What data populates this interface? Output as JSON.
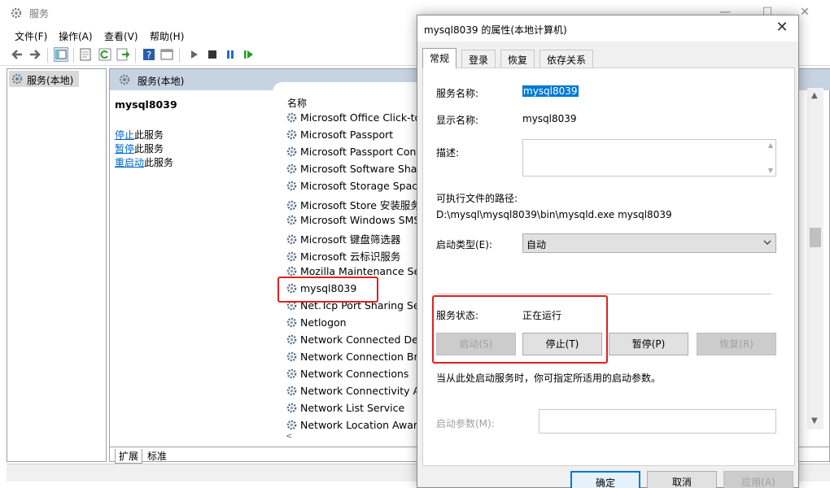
{
  "window": {
    "title": "服务",
    "minimize": "—",
    "maximize": "☐",
    "close": "✕"
  },
  "menu": [
    "文件(F)",
    "操作(A)",
    "查看(V)",
    "帮助(H)"
  ],
  "tree": {
    "root": "服务(本地)"
  },
  "pane_header": "服务(本地)",
  "selected_service": {
    "name": "mysql8039",
    "stop_link": "停止",
    "stop_rest": "此服务",
    "pause_link": "暂停",
    "pause_rest": "此服务",
    "restart_link": "重启动",
    "restart_rest": "此服务"
  },
  "list": {
    "column_name": "名称",
    "items": [
      "Microsoft Office Click-to",
      "Microsoft Passport",
      "Microsoft Passport Cont",
      "Microsoft Software Shad",
      "Microsoft Storage Space",
      "Microsoft Store 安装服务",
      "Microsoft Windows SMS",
      "Microsoft 键盘筛选器",
      "Microsoft 云标识服务",
      "Mozilla Maintenance Ser",
      "mysql8039",
      "Net.Tcp Port Sharing Ser",
      "Netlogon",
      "Network Connected Dev",
      "Network Connection Bro",
      "Network Connections",
      "Network Connectivity As",
      "Network List Service",
      "Network Location Aware"
    ]
  },
  "bottom_tabs": [
    "扩展",
    "标准"
  ],
  "dialog": {
    "title": "mysql8039 的属性(本地计算机)",
    "close": "✕",
    "tabs": [
      "常规",
      "登录",
      "恢复",
      "依存关系"
    ],
    "service_name_label": "服务名称:",
    "service_name_value": "mysql8039",
    "display_name_label": "显示名称:",
    "display_name_value": "mysql8039",
    "description_label": "描述:",
    "exe_path_label": "可执行文件的路径:",
    "exe_path_value": "D:\\mysql\\mysql8039\\bin\\mysqld.exe mysql8039",
    "startup_type_label": "启动类型(E):",
    "startup_type_value": "自动",
    "status_label": "服务状态:",
    "status_value": "正在运行",
    "btn_start": "启动(S)",
    "btn_stop": "停止(T)",
    "btn_pause": "暂停(P)",
    "btn_resume": "恢复(R)",
    "hint": "当从此处启动服务时，你可指定所适用的启动参数。",
    "params_label": "启动参数(M):",
    "params_value": "",
    "btn_ok": "确定",
    "btn_cancel": "取消",
    "btn_apply": "应用(A)"
  },
  "colors": {
    "highlight": "#0078d7",
    "annotation_red": "#e02020",
    "header_blue": "#c6d3e2",
    "link": "#0066cc"
  }
}
